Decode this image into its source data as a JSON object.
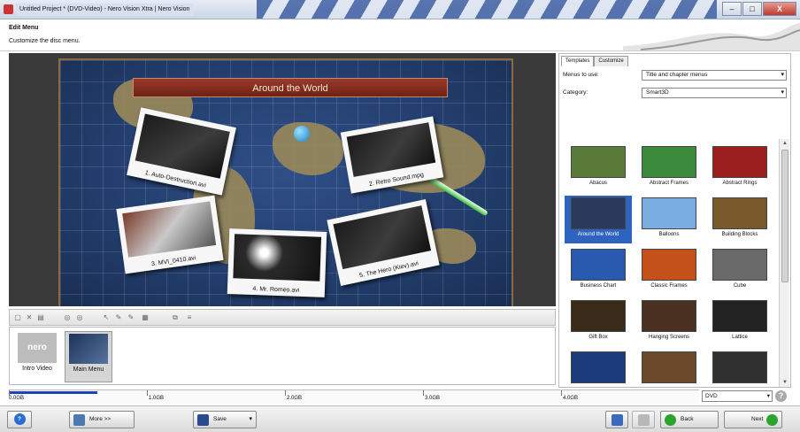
{
  "window": {
    "title": "Untitled Project * (DVD-Video) - Nero Vision Xtra | Nero Vision",
    "controls": {
      "minimize": "–",
      "maximize": "□",
      "close": "X"
    }
  },
  "header": {
    "title": "Edit Menu",
    "subtitle": "Customize the disc menu."
  },
  "preview": {
    "banner": "Around the World",
    "photos": [
      "1. Auto-Destruction.avi",
      "2. Retro Sound.mpg",
      "3. MVI_0410.avi",
      "4. Mr. Romeo.avi",
      "5. The Hero (Kiev).avi"
    ]
  },
  "toolbar": {
    "icons": [
      "page-icon",
      "delete-icon",
      "save-icon",
      "circle-icon",
      "circle-icon",
      "cursor-icon",
      "pen-icon",
      "pen-icon",
      "grid-icon",
      "copy-icon",
      "align-icon"
    ]
  },
  "tray": {
    "items": [
      {
        "label": "Intro Video",
        "selected": false
      },
      {
        "label": "Main Menu",
        "selected": true
      }
    ],
    "intro_logo": "nero"
  },
  "panel": {
    "tabs": [
      "Templates",
      "Customize"
    ],
    "menus_label": "Menus to use:",
    "menus_value": "Title and chapter menus",
    "category_label": "Category:",
    "category_value": "Smart3D",
    "templates": [
      {
        "name": "Abacus",
        "color": "#5a7a3a",
        "selected": false
      },
      {
        "name": "Abstract Frames",
        "color": "#3c8a3c",
        "selected": false
      },
      {
        "name": "Abstract Rings",
        "color": "#9a1e1e",
        "selected": false
      },
      {
        "name": "Around the World",
        "color": "#2a3a5a",
        "selected": true
      },
      {
        "name": "Balloons",
        "color": "#7aaee0",
        "selected": false
      },
      {
        "name": "Building Blocks",
        "color": "#7a5a2a",
        "selected": false
      },
      {
        "name": "Business Chart",
        "color": "#2a5ab0",
        "selected": false
      },
      {
        "name": "Classic Frames",
        "color": "#c4501a",
        "selected": false
      },
      {
        "name": "Cube",
        "color": "#6a6a6a",
        "selected": false
      },
      {
        "name": "Gift Box",
        "color": "#3a2a1a",
        "selected": false
      },
      {
        "name": "Hanging Screens",
        "color": "#4a3020",
        "selected": false
      },
      {
        "name": "Lattice",
        "color": "#222222",
        "selected": false
      },
      {
        "name": "",
        "color": "#1a3a7a",
        "selected": false
      },
      {
        "name": "",
        "color": "#6a4a2a",
        "selected": false
      },
      {
        "name": "",
        "color": "#303030",
        "selected": false
      }
    ]
  },
  "capacity": {
    "labels": [
      "0.0GB",
      "1.0GB",
      "2.0GB",
      "3.0GB",
      "4.0GB"
    ],
    "used_fraction": 0.02,
    "disc_type": "DVD"
  },
  "buttons": {
    "help": "?",
    "more": "More >>",
    "save": "Save",
    "back": "Back",
    "next": "Next"
  },
  "colors": {
    "accent": "#2e64c0",
    "banner": "#8a2e20",
    "capacity_fill": "#1b43c0"
  }
}
